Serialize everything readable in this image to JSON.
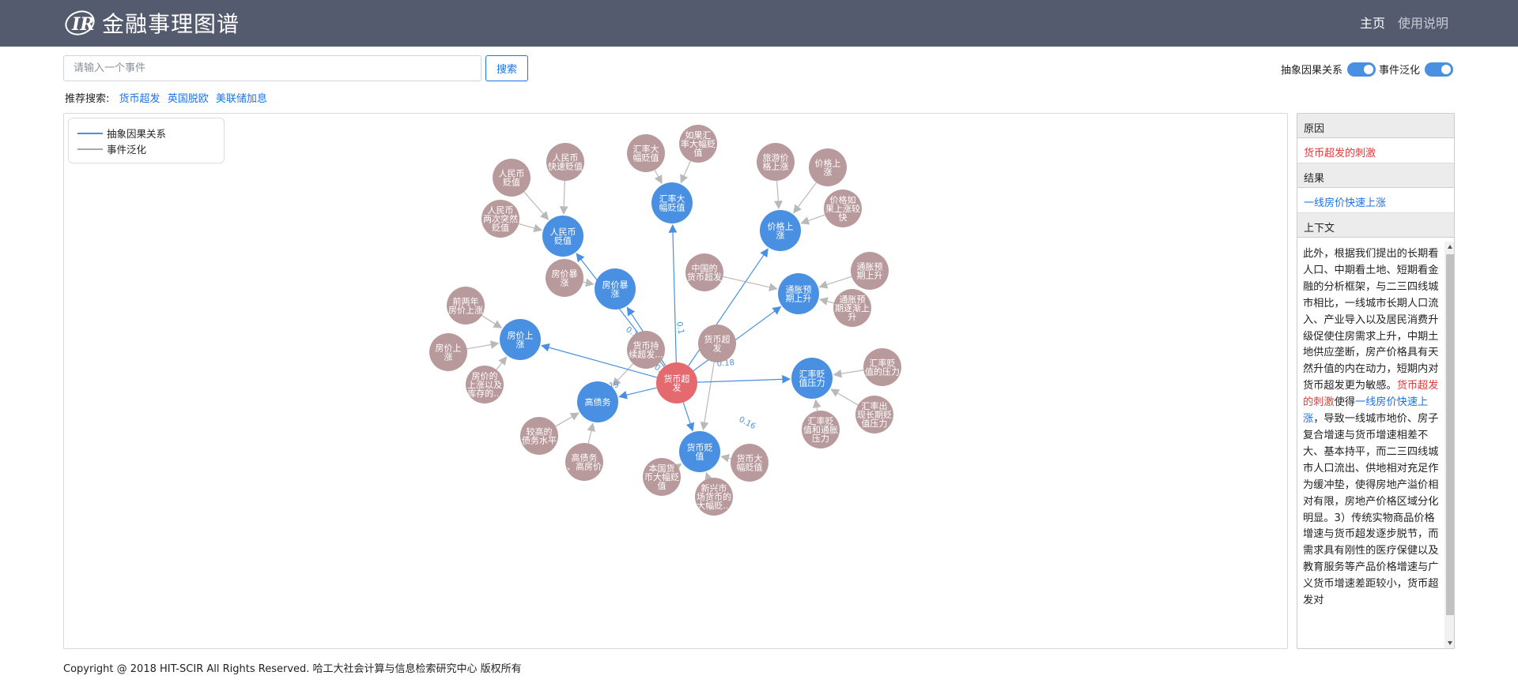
{
  "navbar": {
    "logo_text": "IR",
    "title": "金融事理图谱",
    "links": {
      "home": "主页",
      "help": "使用说明"
    }
  },
  "search": {
    "placeholder": "请输入一个事件",
    "value": "",
    "button_label": "搜索"
  },
  "toggles": [
    {
      "label": "抽象因果关系",
      "on": true
    },
    {
      "label": "事件泛化",
      "on": true
    }
  ],
  "recommend": {
    "label": "推荐搜索:",
    "tags": [
      "货币超发",
      "英国脱欧",
      "美联储加息"
    ]
  },
  "legend": [
    {
      "label": "抽象因果关系",
      "color": "#4a90e2"
    },
    {
      "label": "事件泛化",
      "color": "#aaaaaa"
    }
  ],
  "colors": {
    "center_node": "#e56a6f",
    "abstract_node": "#4a90e2",
    "generalized_node": "#b99a9c",
    "causal_edge": "#4a90e2",
    "generalize_edge": "#b9b9b9"
  },
  "graph": {
    "center": {
      "lines": [
        "货币超",
        "发"
      ]
    },
    "nodes": [
      {
        "id": "rmb",
        "lines": [
          "人民币",
          "贬值"
        ]
      },
      {
        "id": "hlbz",
        "lines": [
          "汇率大",
          "幅贬值"
        ]
      },
      {
        "id": "jgss",
        "lines": [
          "价格上",
          "涨"
        ]
      },
      {
        "id": "fjbz",
        "lines": [
          "房价暴",
          "涨"
        ]
      },
      {
        "id": "tzyq",
        "lines": [
          "通胀预",
          "期上升"
        ]
      },
      {
        "id": "fjsz",
        "lines": [
          "房价上",
          "涨"
        ]
      },
      {
        "id": "hlbzyl",
        "lines": [
          "汇率贬",
          "值压力"
        ]
      },
      {
        "id": "gzw",
        "lines": [
          "高债务"
        ]
      },
      {
        "id": "hbbz",
        "lines": [
          "货币贬",
          "值"
        ]
      }
    ],
    "generalized": [
      {
        "lines": [
          "人民币",
          "快速贬值"
        ]
      },
      {
        "lines": [
          "人民币",
          "贬值"
        ]
      },
      {
        "lines": [
          "人民币",
          "两次突然",
          "贬值"
        ]
      },
      {
        "lines": [
          "汇率大",
          "幅贬值"
        ]
      },
      {
        "lines": [
          "如果汇",
          "率大幅贬",
          "值"
        ]
      },
      {
        "lines": [
          "旅游价",
          "格上涨"
        ]
      },
      {
        "lines": [
          "价格上",
          "涨"
        ]
      },
      {
        "lines": [
          "价格如",
          "果上涨较",
          "快"
        ]
      },
      {
        "lines": [
          "中国的",
          "货币超发"
        ]
      },
      {
        "lines": [
          "房价暴",
          "涨"
        ]
      },
      {
        "lines": [
          "通胀预",
          "期上升"
        ]
      },
      {
        "lines": [
          "通胀预",
          "期逐渐上",
          "升"
        ]
      },
      {
        "lines": [
          "前两年",
          "房价上涨"
        ]
      },
      {
        "lines": [
          "房价上",
          "涨"
        ]
      },
      {
        "lines": [
          "房价的",
          "上涨以及",
          "库存的..."
        ]
      },
      {
        "lines": [
          "货币持",
          "续超发..."
        ]
      },
      {
        "lines": [
          "货币超",
          "发"
        ]
      },
      {
        "lines": [
          "汇率贬",
          "值的压力"
        ]
      },
      {
        "lines": [
          "汇率出",
          "现长期贬",
          "值压力"
        ]
      },
      {
        "lines": [
          "汇率贬",
          "值和通胀",
          "压力"
        ]
      },
      {
        "lines": [
          "较高的",
          "债务水平"
        ]
      },
      {
        "lines": [
          "高债务",
          "、高房价"
        ]
      },
      {
        "lines": [
          "本国货",
          "币大幅贬",
          "值"
        ]
      },
      {
        "lines": [
          "新兴市",
          "场货币的",
          "大幅贬..."
        ]
      },
      {
        "lines": [
          "货币大",
          "幅贬值"
        ]
      }
    ],
    "edge_weights": [
      "0.14",
      "0.1",
      "0.18",
      "0.19",
      "0.16",
      "0.15",
      "0.1"
    ]
  },
  "side": {
    "cause_header": "原因",
    "cause": "货币超发的刺激",
    "effect_header": "结果",
    "effect": "一线房价快速上涨",
    "context_header": "上下文",
    "context_before": "此外，根据我们提出的长期看人口、中期看土地、短期看金融的分析框架，与二三四线城市相比，一线城市长期人口流入、产业导入以及居民消费升级促使住房需求上升，中期土地供应垄断，房产价格具有天然升值的内在动力，短期内对货币超发更为敏感。",
    "context_cause": "货币超发的刺激",
    "context_mid": "使得",
    "context_effect": "一线房价快速上涨",
    "context_after": "，导致一线城市地价、房子复合增速与货币增速相差不大、基本持平，而二三四线城市人口流出、供地相对充足作为缓冲垫，使得房地产溢价相对有限，房地产价格区域分化明显。3）传统实物商品价格增速与货币超发逐步脱节，而需求具有刚性的医疗保健以及教育服务等产品价格增速与广义货币增速差距较小，货币超发对"
  },
  "footer": "Copyright @ 2018 HIT-SCIR All Rights Reserved. 哈工大社会计算与信息检索研究中心 版权所有"
}
